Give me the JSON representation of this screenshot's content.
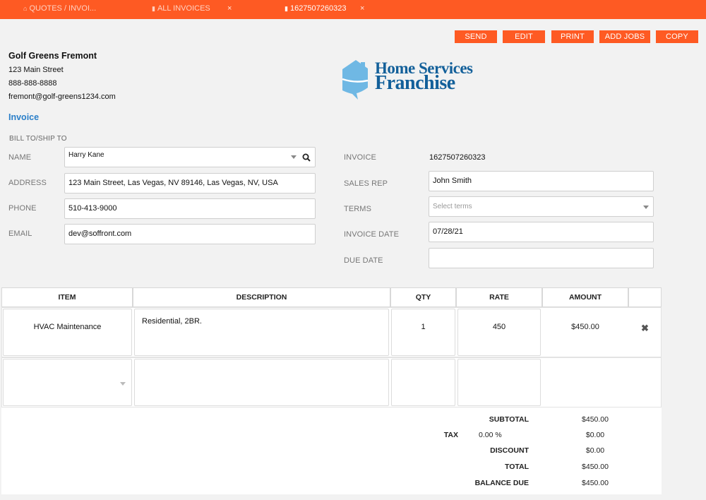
{
  "tabs": [
    {
      "label": "QUOTES / INVOI...",
      "icon": "home-icon"
    },
    {
      "label": "ALL INVOICES",
      "icon": "document-icon"
    },
    {
      "label": "1627507260323",
      "icon": "document-icon"
    }
  ],
  "tab_close_glyph": "×",
  "actions": {
    "send": "SEND",
    "edit": "EDIT",
    "print": "PRINT",
    "add_jobs": "ADD JOBS",
    "copy": "COPY"
  },
  "company": {
    "name": "Golf Greens Fremont",
    "street": "123 Main Street",
    "phone": "888-888-8888",
    "email": "fremont@golf-greens1234.com"
  },
  "logo": {
    "line1": "Home Services",
    "line2": "Franchise"
  },
  "doc_type": "Invoice",
  "bill_section_label": "BILL TO/SHIP TO",
  "bill_to": {
    "name_label": "NAME",
    "name": "Harry Kane",
    "address_label": "ADDRESS",
    "address": "123 Main Street, Las Vegas, NV 89146, Las Vegas, NV, USA",
    "phone_label": "PHONE",
    "phone": "510-413-9000",
    "email_label": "EMAIL",
    "email": "dev@soffront.com"
  },
  "invoice_info": {
    "invoice_label": "INVOICE",
    "invoice_number": "1627507260323",
    "sales_rep_label": "SALES REP",
    "sales_rep": "John Smith",
    "terms_label": "TERMS",
    "terms_placeholder": "Select terms",
    "invoice_date_label": "INVOICE DATE",
    "invoice_date": "07/28/21",
    "due_date_label": "DUE DATE",
    "due_date": ""
  },
  "table": {
    "headers": {
      "item": "ITEM",
      "description": "DESCRIPTION",
      "qty": "QTY",
      "rate": "RATE",
      "amount": "AMOUNT"
    },
    "rows": [
      {
        "item": "HVAC Maintenance",
        "description": "Residential, 2BR.",
        "qty": "1",
        "rate": "450",
        "amount": "$450.00"
      }
    ],
    "delete_glyph": "✖"
  },
  "totals": {
    "subtotal_label": "SUBTOTAL",
    "subtotal": "$450.00",
    "tax_label": "TAX",
    "tax_rate": "0.00 %",
    "tax": "$0.00",
    "discount_label": "DISCOUNT",
    "discount": "$0.00",
    "total_label": "TOTAL",
    "total": "$450.00",
    "balance_label": "BALANCE DUE",
    "balance": "$450.00"
  },
  "colors": {
    "accent": "#fe5a23",
    "link": "#2a7fc9",
    "logo_text": "#13609a",
    "logo_house": "#6fb8e4"
  }
}
